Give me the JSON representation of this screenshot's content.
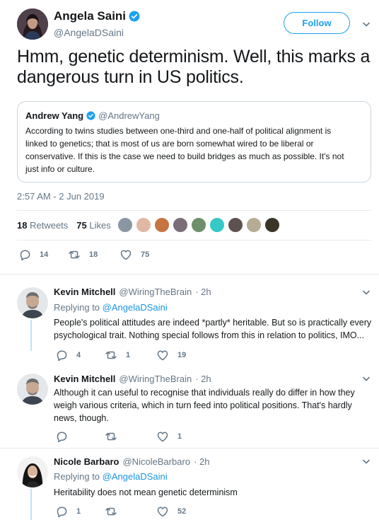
{
  "tweet": {
    "author_name": "Angela Saini",
    "author_handle": "@AngelaDSaini",
    "follow_label": "Follow",
    "text": "Hmm, genetic determinism. Well, this marks a dangerous turn in US politics.",
    "timestamp": "2:57 AM - 2 Jun 2019",
    "retweets_count": "18",
    "retweets_label": "Retweets",
    "likes_count": "75",
    "likes_label": "Likes",
    "actions": {
      "replies": "14",
      "retweets": "18",
      "likes": "75"
    }
  },
  "quote": {
    "author_name": "Andrew Yang",
    "author_handle": "@AndrewYang",
    "text": "According to twins studies between one-third and one-half of political alignment is linked to genetics; that is most of us are born somewhat wired to be liberal or conservative. If this is the case we need to build bridges as much as possible. It's not just info or culture."
  },
  "likers_colors": [
    "#8a97a3",
    "#e0b8a4",
    "#c77443",
    "#7c6d78",
    "#6d8f6a",
    "#36c9c6",
    "#5e5251",
    "#b6ab94",
    "#3a3526"
  ],
  "replies": [
    {
      "name": "Kevin Mitchell",
      "handle": "@WiringTheBrain",
      "time": "· 2h",
      "replying_prefix": "Replying to",
      "replying_handle": "@AngelaDSaini",
      "text": "People's political attitudes are indeed *partly* heritable. But so is practically every psychological trait. Nothing special follows from this in relation to politics, IMO...",
      "replies": "4",
      "retweets": "1",
      "likes": "19"
    },
    {
      "name": "Kevin Mitchell",
      "handle": "@WiringTheBrain",
      "time": "· 2h",
      "text": "Although it can useful to recognise that individuals really do differ in how they weigh various criteria, which in turn feed into political positions. That's hardly news, though.",
      "replies": "",
      "retweets": "",
      "likes": "1"
    },
    {
      "name": "Nicole Barbaro",
      "handle": "@NicoleBarbaro",
      "time": "· 2h",
      "replying_prefix": "Replying to",
      "replying_handle": "@AngelaDSaini",
      "text": "Heritability does not mean genetic determinism",
      "replies": "1",
      "retweets": "",
      "likes": "52"
    }
  ]
}
